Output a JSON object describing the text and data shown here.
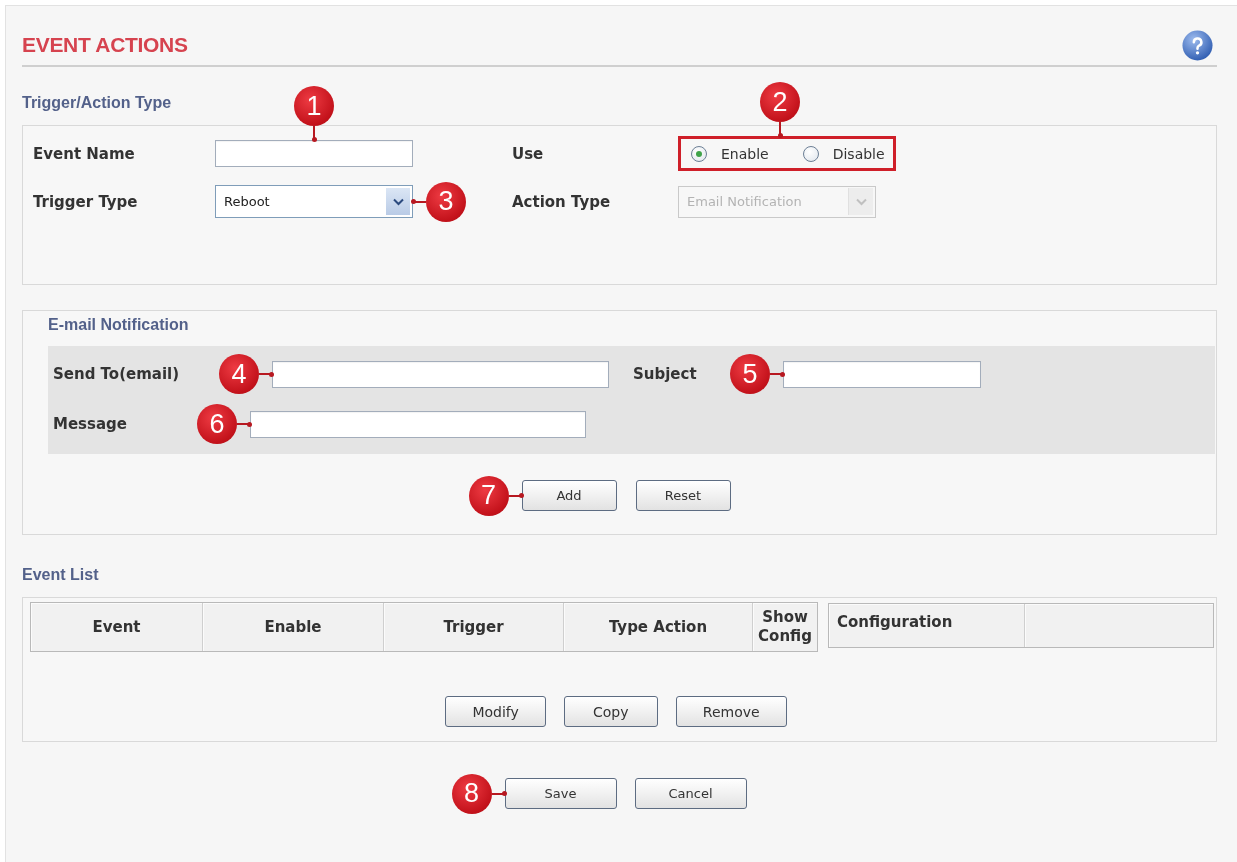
{
  "page": {
    "title": "EVENT ACTIONS"
  },
  "trigger_section": {
    "heading": "Trigger/Action Type",
    "event_name": {
      "label": "Event Name",
      "callout": "1"
    },
    "use": {
      "label": "Use",
      "callout": "2",
      "options": [
        {
          "label": "Enable",
          "selected": true
        },
        {
          "label": "Disable",
          "selected": false
        }
      ]
    },
    "trigger_type": {
      "label": "Trigger Type",
      "value": "Reboot",
      "callout": "3"
    },
    "action_type": {
      "label": "Action Type",
      "value": "Email Notification",
      "disabled": true
    }
  },
  "email_section": {
    "heading": "E-mail Notification",
    "send_to": {
      "label": "Send To(email)",
      "callout": "4"
    },
    "subject": {
      "label": "Subject",
      "callout": "5"
    },
    "message": {
      "label": "Message",
      "callout": "6"
    },
    "buttons": [
      {
        "label": "Add",
        "callout": "7"
      },
      {
        "label": "Reset"
      }
    ]
  },
  "event_list": {
    "heading": "Event List",
    "columns": [
      "Event",
      "Enable",
      "Trigger",
      "Type Action",
      "Show Config"
    ],
    "config_columns": [
      "Configuration"
    ],
    "buttons": [
      {
        "label": "Modify"
      },
      {
        "label": "Copy"
      },
      {
        "label": "Remove"
      }
    ]
  },
  "footer_buttons": [
    {
      "label": "Save",
      "callout": "8"
    },
    {
      "label": "Cancel"
    }
  ]
}
